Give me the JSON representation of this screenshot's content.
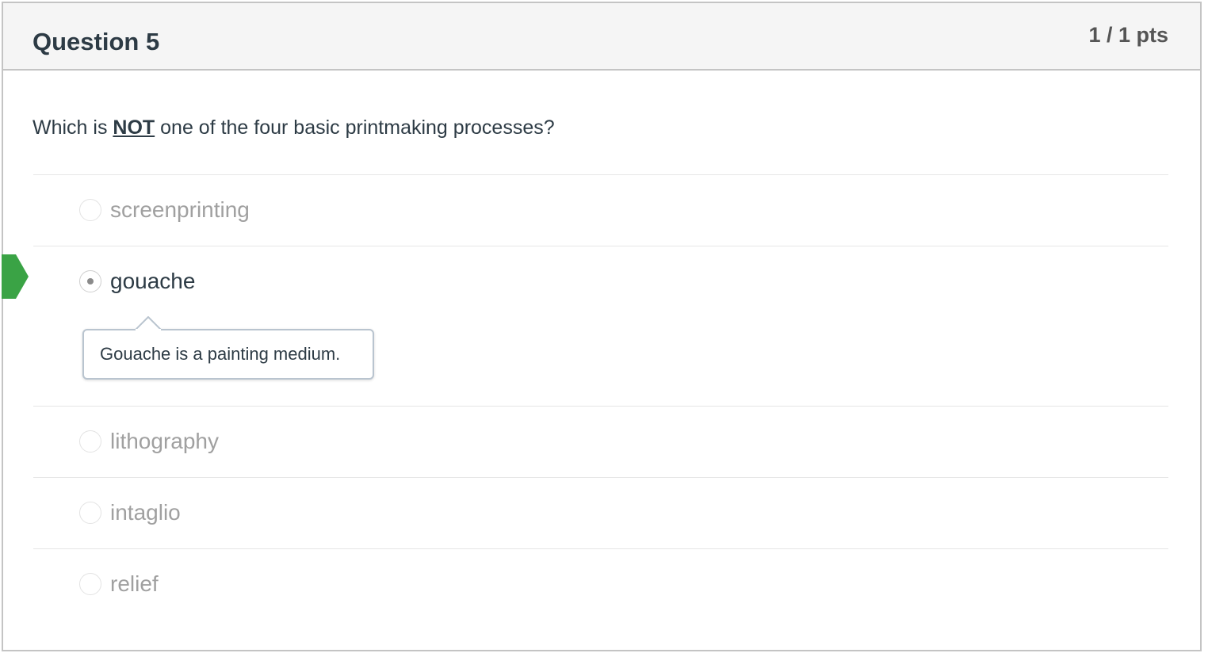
{
  "question": {
    "title": "Question 5",
    "points": "1 / 1 pts",
    "text_before": "Which is ",
    "text_emphasis": "NOT",
    "text_after": " one of the four basic printmaking processes?"
  },
  "answers": [
    {
      "label": "screenprinting",
      "selected": false
    },
    {
      "label": "gouache",
      "selected": true,
      "correct": true,
      "feedback": "Gouache is a painting medium."
    },
    {
      "label": "lithography",
      "selected": false
    },
    {
      "label": "intaglio",
      "selected": false
    },
    {
      "label": "relief",
      "selected": false
    }
  ],
  "icons": {
    "correct_indicator": "correct-answer-arrow-icon",
    "radio": "radio-button-icon"
  },
  "colors": {
    "correct_green": "#3aa345",
    "header_bg": "#f5f5f5",
    "border": "#c4c4c4"
  }
}
